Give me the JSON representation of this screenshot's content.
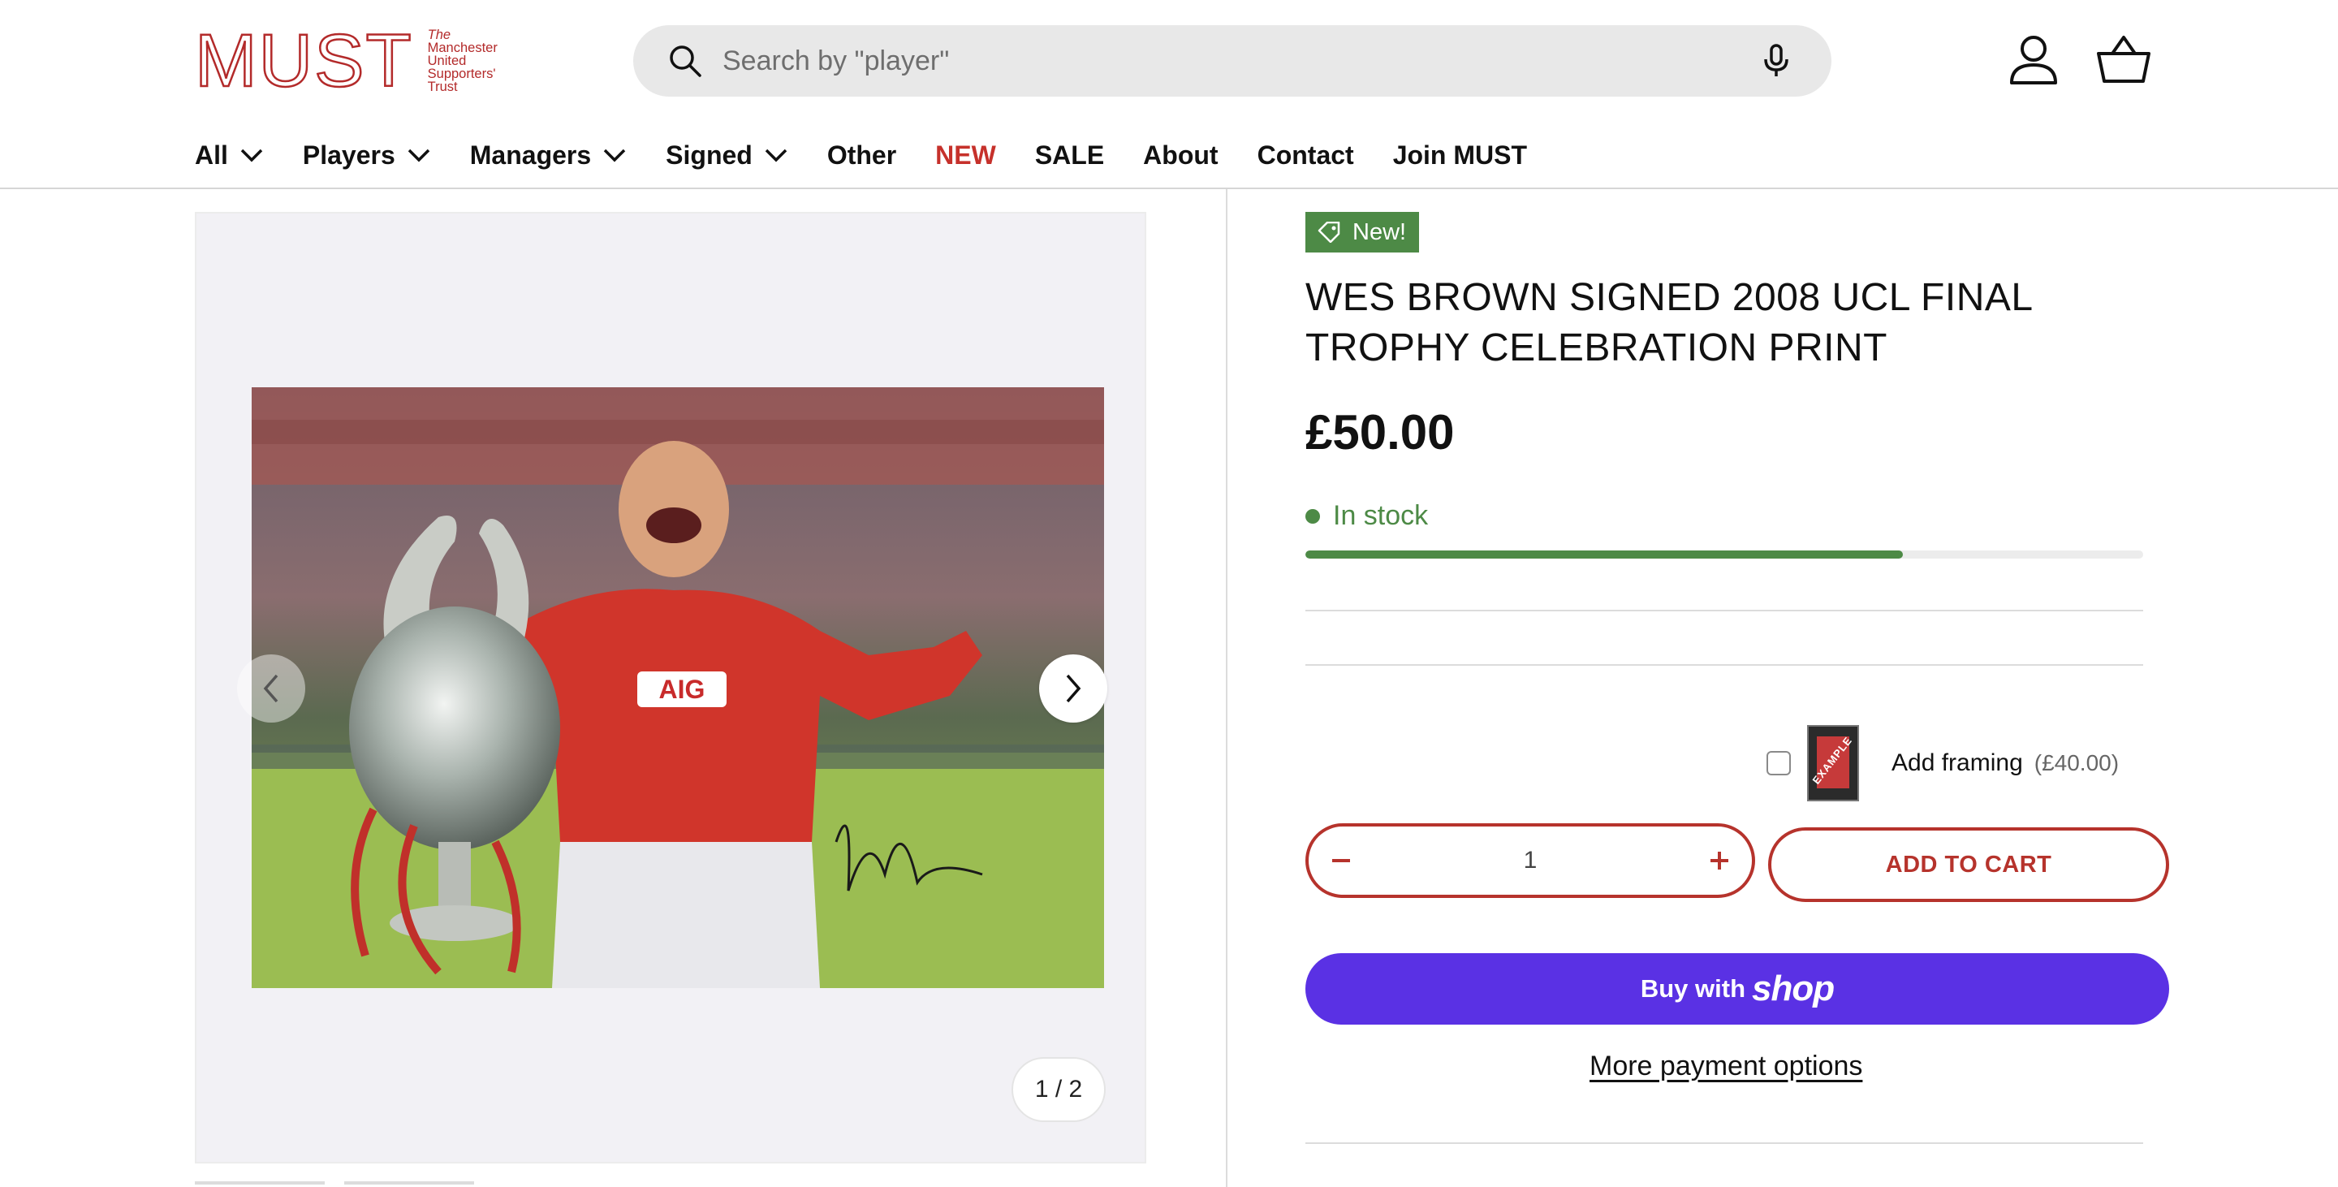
{
  "brand": {
    "logo_text": "MUST",
    "tagline": [
      "The",
      "Manchester",
      "United",
      "Supporters'",
      "Trust"
    ],
    "color": "#b32a2a"
  },
  "search": {
    "placeholder": "Search by \"player\"",
    "icon": "search-icon",
    "voice_icon": "microphone-icon"
  },
  "header_icons": {
    "account": "account-icon",
    "cart": "basket-icon"
  },
  "nav": {
    "items": [
      {
        "label": "All",
        "dropdown": true
      },
      {
        "label": "Players",
        "dropdown": true
      },
      {
        "label": "Managers",
        "dropdown": true
      },
      {
        "label": "Signed",
        "dropdown": true
      },
      {
        "label": "Other",
        "dropdown": false
      },
      {
        "label": "NEW",
        "dropdown": false,
        "highlight": "#c6312b"
      },
      {
        "label": "SALE",
        "dropdown": false
      },
      {
        "label": "About",
        "dropdown": false
      },
      {
        "label": "Contact",
        "dropdown": false
      },
      {
        "label": "Join MUST",
        "dropdown": false
      }
    ]
  },
  "gallery": {
    "counter": "1 / 2",
    "current": 1,
    "total": 2
  },
  "product": {
    "badge": "New!",
    "title": "WES BROWN SIGNED 2008 UCL FINAL TROPHY CELEBRATION PRINT",
    "price": "£50.00",
    "stock_label": "In stock",
    "stock_level": 0.713,
    "stock_color": "#4d8a46",
    "addon": {
      "label": "Add framing",
      "price": "(£40.00)",
      "checked": false,
      "thumb_text": "EXAMPLE"
    },
    "quantity": "1",
    "add_to_cart": "ADD TO CART",
    "shop_pay": {
      "prefix": "Buy with",
      "brand": "shop"
    },
    "more_payment": "More payment options",
    "accent_color": "#b6332c",
    "shop_pay_color": "#5a31e4"
  }
}
